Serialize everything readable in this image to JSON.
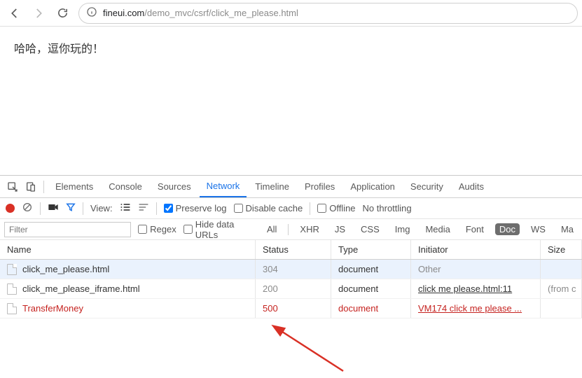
{
  "browser": {
    "url_host": "fineui.com",
    "url_path": "/demo_mvc/csrf/click_me_please.html"
  },
  "page": {
    "body_text": "哈哈，逗你玩的！"
  },
  "devtools": {
    "tabs": {
      "elements": "Elements",
      "console": "Console",
      "sources": "Sources",
      "network": "Network",
      "timeline": "Timeline",
      "profiles": "Profiles",
      "application": "Application",
      "security": "Security",
      "audits": "Audits"
    },
    "active_tab": "network",
    "toolbar": {
      "view_label": "View:",
      "preserve_log": "Preserve log",
      "disable_cache": "Disable cache",
      "offline": "Offline",
      "throttling": "No throttling"
    },
    "filterbar": {
      "filter_placeholder": "Filter",
      "regex": "Regex",
      "hide_data_urls": "Hide data URLs",
      "types": {
        "all": "All",
        "xhr": "XHR",
        "js": "JS",
        "css": "CSS",
        "img": "Img",
        "media": "Media",
        "font": "Font",
        "doc": "Doc",
        "ws": "WS",
        "ma": "Ma"
      },
      "active_type": "doc"
    },
    "columns": {
      "name": "Name",
      "status": "Status",
      "type": "Type",
      "initiator": "Initiator",
      "size": "Size"
    },
    "rows": [
      {
        "name": "click_me_please.html",
        "status": "304",
        "type": "document",
        "initiator": "Other",
        "size": "",
        "err": false,
        "init_link": false,
        "selected": true
      },
      {
        "name": "click_me_please_iframe.html",
        "status": "200",
        "type": "document",
        "initiator": "click me please.html:11",
        "size": "(from c",
        "err": false,
        "init_link": true,
        "selected": false
      },
      {
        "name": "TransferMoney",
        "status": "500",
        "type": "document",
        "initiator": "VM174 click me please ...",
        "size": "",
        "err": true,
        "init_link": true,
        "selected": false
      }
    ]
  }
}
